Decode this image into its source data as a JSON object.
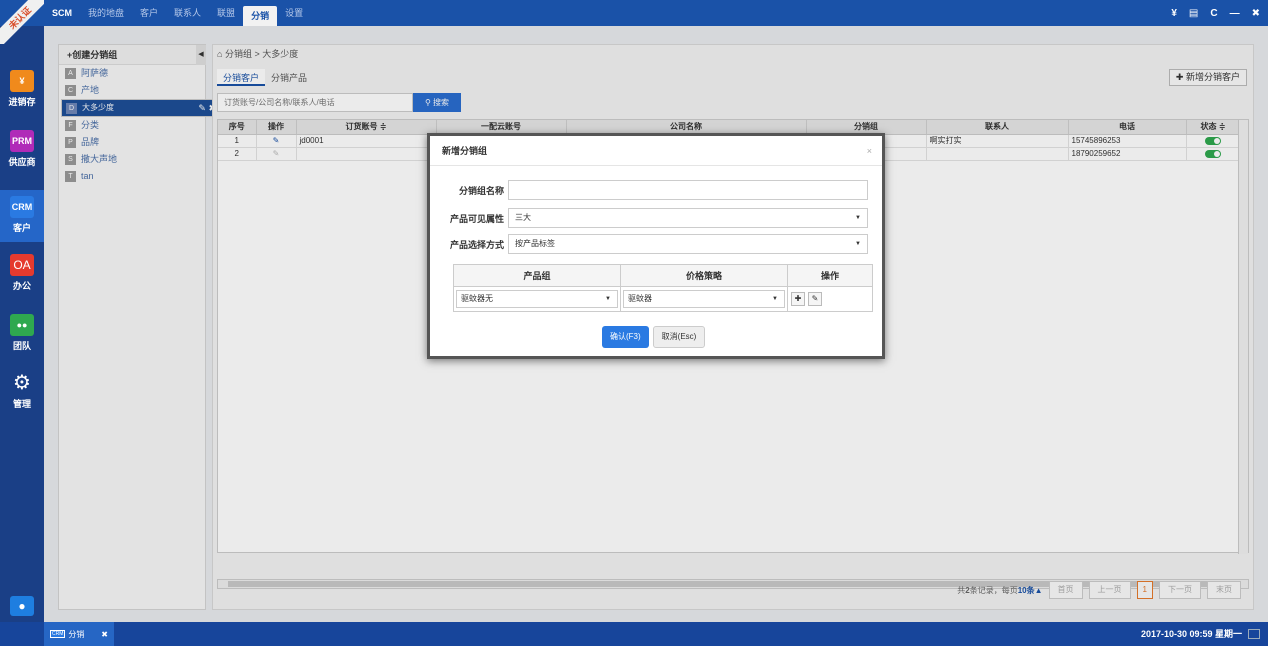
{
  "corner_badge": "未认证",
  "topnav": [
    "SCM",
    "我的地盘",
    "客户",
    "联系人",
    "联盟",
    "分销",
    "设置"
  ],
  "topnav_active": "分销",
  "top_icons": [
    "¥",
    "chat-icon",
    "refresh-icon",
    "minimize-icon",
    "close-icon"
  ],
  "sidebar": [
    {
      "tile": "¥",
      "label": "进销存",
      "color": "#f08a1c"
    },
    {
      "tile": "PRM",
      "label": "供应商",
      "color": "#b02bb8"
    },
    {
      "tile": "CRM",
      "label": "客户",
      "color": "#2a7ae2"
    },
    {
      "tile": "OA",
      "label": "办公",
      "color": "#e53a2e"
    },
    {
      "tile": "",
      "label": "团队",
      "color": "#2fa84f"
    },
    {
      "tile": "",
      "label": "管理",
      "color": "#1a3f86"
    }
  ],
  "tree": {
    "create_label": "+创建分销组",
    "items": [
      {
        "letter": "A",
        "label": "阿萨德"
      },
      {
        "letter": "C",
        "label": "产地"
      },
      {
        "letter": "D",
        "label": "大多少度"
      },
      {
        "letter": "F",
        "label": "分类"
      },
      {
        "letter": "P",
        "label": "品牌"
      },
      {
        "letter": "S",
        "label": "撒大声地"
      },
      {
        "letter": "T",
        "label": "tan"
      }
    ],
    "selected": "大多少度"
  },
  "breadcrumb": "分销组 > 大多少度",
  "tabs": [
    "分销客户",
    "分销产品"
  ],
  "new_customer_button": "新增分销客户",
  "search": {
    "placeholder": "订货账号/公司名称/联系人/电话",
    "button": "搜索"
  },
  "table": {
    "headers": [
      "序号",
      "操作",
      "订货账号 ≑",
      "一配云账号",
      "公司名称",
      "分销组",
      "联系人",
      "电话",
      "状态 ≑"
    ],
    "rows": [
      {
        "no": "1",
        "account": "jd0001",
        "cloud": "",
        "company": "",
        "group": "",
        "contact": "啊实打实",
        "phone": "15745896253"
      },
      {
        "no": "2",
        "account": "",
        "cloud": "",
        "company": "",
        "group": "",
        "contact": "",
        "phone": "18790259652"
      }
    ]
  },
  "pager": {
    "summary_prefix": "共",
    "total": "2",
    "summary_mid": "条记录，每页",
    "per_page": "10",
    "summary_suffix": "条",
    "buttons": [
      "首页",
      "上一页",
      "1",
      "下一页",
      "末页"
    ]
  },
  "modal": {
    "title": "新增分销组",
    "close": "×",
    "fields": [
      {
        "label": "分销组名称",
        "value": ""
      },
      {
        "label": "产品可见属性",
        "value": "三大"
      },
      {
        "label": "产品选择方式",
        "value": "按产品标签"
      }
    ],
    "product_table": {
      "headers": [
        "产品组",
        "价格策略",
        "操作"
      ],
      "row": {
        "group": "驱蚊器无",
        "price": "驱蚊器"
      }
    },
    "confirm": "确认(F3)",
    "cancel": "取消(Esc)"
  },
  "taskbar": {
    "task_tag": "CRM",
    "task_label": "分销",
    "clock": "2017-10-30 09:59 星期一"
  }
}
